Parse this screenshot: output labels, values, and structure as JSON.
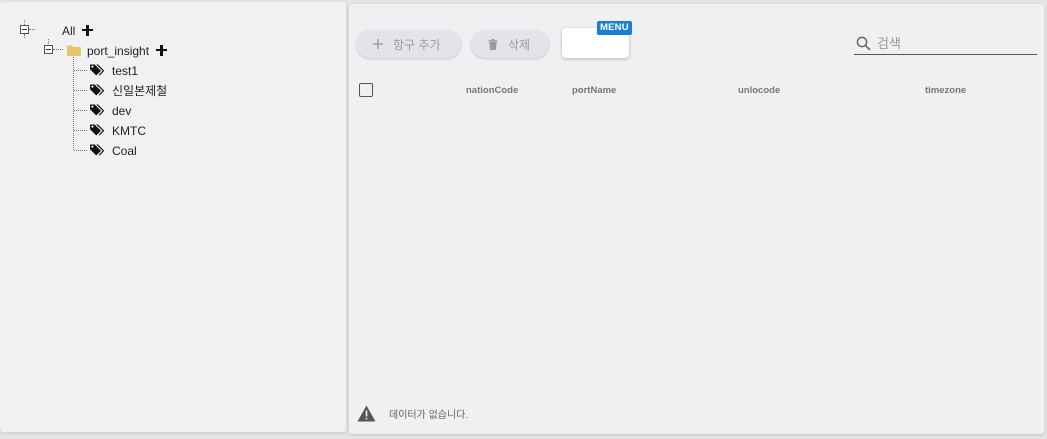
{
  "tree": {
    "root": {
      "label": "All"
    },
    "group": {
      "label": "port_insight"
    },
    "items": [
      {
        "label": "test1"
      },
      {
        "label": "신일본제철"
      },
      {
        "label": "dev"
      },
      {
        "label": "KMTC"
      },
      {
        "label": "Coal"
      }
    ]
  },
  "toolbar": {
    "add_label": "항구 추가",
    "delete_label": "삭제",
    "menu_badge": "MENU",
    "search_placeholder": "검색"
  },
  "table": {
    "columns": [
      "nationCode",
      "portName",
      "unlocode",
      "timezone"
    ],
    "empty_message": "데이터가 없습니다."
  },
  "colors": {
    "menu_badge": "#1a7fd4",
    "folder": "#e8c46a"
  }
}
